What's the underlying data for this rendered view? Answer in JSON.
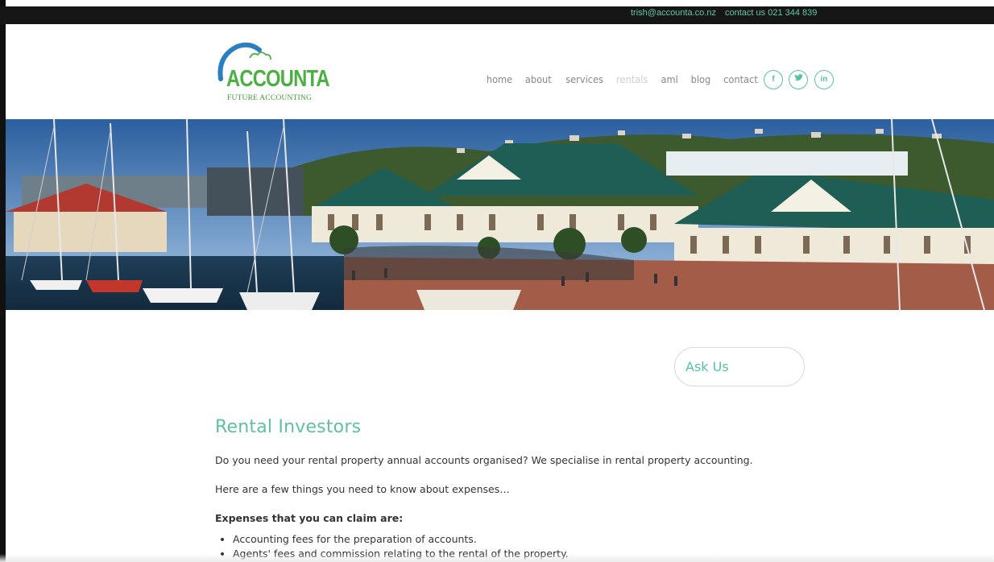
{
  "topbar": {
    "email": "trish@accounta.co.nz",
    "contact_label": "contact us 021 344 839"
  },
  "logo": {
    "name": "ACCOUNTA",
    "tagline": "FUTURE ACCOUNTING",
    "icon": "arc-and-cloud-logo"
  },
  "nav": {
    "items": [
      {
        "label": "home"
      },
      {
        "label": "about"
      },
      {
        "label": "services"
      },
      {
        "label": "rentals",
        "active": true
      },
      {
        "label": "aml"
      },
      {
        "label": "blog"
      },
      {
        "label": "contact"
      }
    ]
  },
  "social": {
    "facebook": "f",
    "twitter": "t",
    "linkedin": "in"
  },
  "hero": {
    "description_icon": "marina-photo"
  },
  "ask_us": {
    "label": "Ask Us"
  },
  "content": {
    "title": "Rental Investors",
    "intro": "Do you need your rental property annual accounts organised? We specialise in rental property accounting.",
    "lead": "Here are a few things you need to know about expenses…",
    "subheading": "Expenses that you can claim are:",
    "list": [
      "Accounting fees for the preparation of accounts.",
      "Agents' fees and commission relating to the rental of the property."
    ]
  },
  "colors": {
    "accent": "#56c2a2",
    "logo_green": "#4caf42",
    "logo_blue": "#2a7fc1",
    "topbar_bg": "#161616"
  }
}
